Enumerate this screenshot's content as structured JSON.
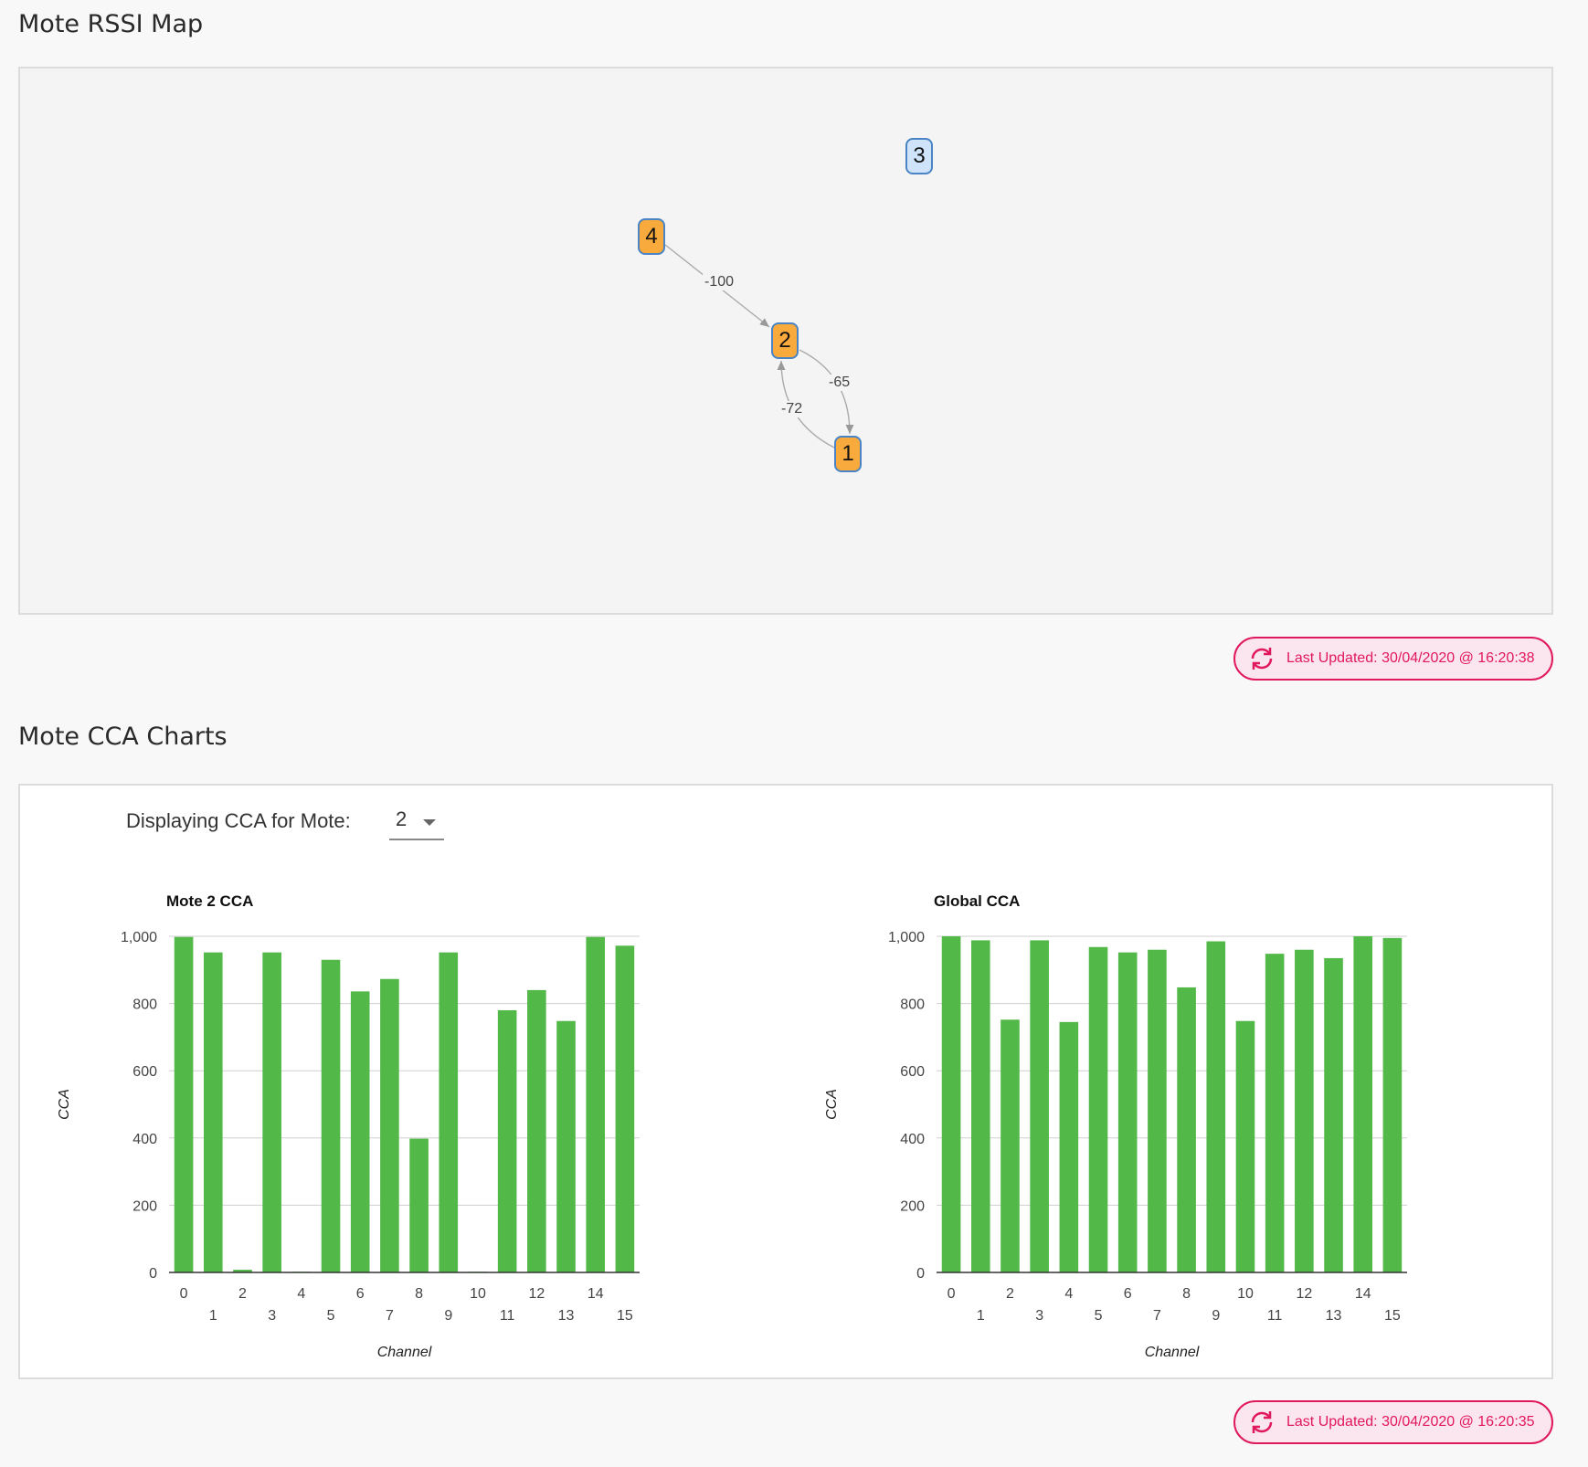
{
  "rssi_section": {
    "title": "Mote RSSI Map",
    "nodes": [
      {
        "id": "3",
        "color": "blue"
      },
      {
        "id": "4",
        "color": "orange"
      },
      {
        "id": "2",
        "color": "orange"
      },
      {
        "id": "1",
        "color": "orange"
      }
    ],
    "edges": [
      {
        "from": "4",
        "to": "2",
        "rssi": "-100"
      },
      {
        "from": "2",
        "to": "1",
        "rssi": "-65"
      },
      {
        "from": "1",
        "to": "2",
        "rssi": "-72"
      }
    ],
    "last_updated": "Last Updated: 30/04/2020 @ 16:20:38",
    "refresh_icon": "refresh-icon"
  },
  "cca_section": {
    "title": "Mote CCA Charts",
    "selector_label": "Displaying CCA for Mote:",
    "selected_mote": "2",
    "last_updated": "Last Updated: 30/04/2020 @ 16:20:35",
    "refresh_icon": "refresh-icon"
  },
  "colors": {
    "accent": "#e0185c",
    "bar": "#52b848",
    "node_orange": "#f9aa3c",
    "node_blue": "#cfe4fb",
    "node_border": "#4a84c4"
  },
  "chart_data": [
    {
      "type": "bar",
      "title": "Mote 2 CCA",
      "xlabel": "Channel",
      "ylabel": "CCA",
      "ylim": [
        0,
        1000
      ],
      "yticks": [
        "0",
        "200",
        "400",
        "600",
        "800",
        "1,000"
      ],
      "categories": [
        "0",
        "1",
        "2",
        "3",
        "4",
        "5",
        "6",
        "7",
        "8",
        "9",
        "10",
        "11",
        "12",
        "13",
        "14",
        "15"
      ],
      "values": [
        998,
        952,
        8,
        952,
        2,
        930,
        836,
        873,
        398,
        952,
        2,
        780,
        840,
        748,
        998,
        972
      ],
      "grid": true,
      "legend": "none"
    },
    {
      "type": "bar",
      "title": "Global CCA",
      "xlabel": "Channel",
      "ylabel": "CCA",
      "ylim": [
        0,
        1000
      ],
      "yticks": [
        "0",
        "200",
        "400",
        "600",
        "800",
        "1,000"
      ],
      "categories": [
        "0",
        "1",
        "2",
        "3",
        "4",
        "5",
        "6",
        "7",
        "8",
        "9",
        "10",
        "11",
        "12",
        "13",
        "14",
        "15"
      ],
      "values": [
        1000,
        988,
        752,
        988,
        745,
        968,
        952,
        960,
        848,
        985,
        748,
        948,
        960,
        935,
        1000,
        995
      ],
      "grid": true,
      "legend": "none"
    }
  ]
}
